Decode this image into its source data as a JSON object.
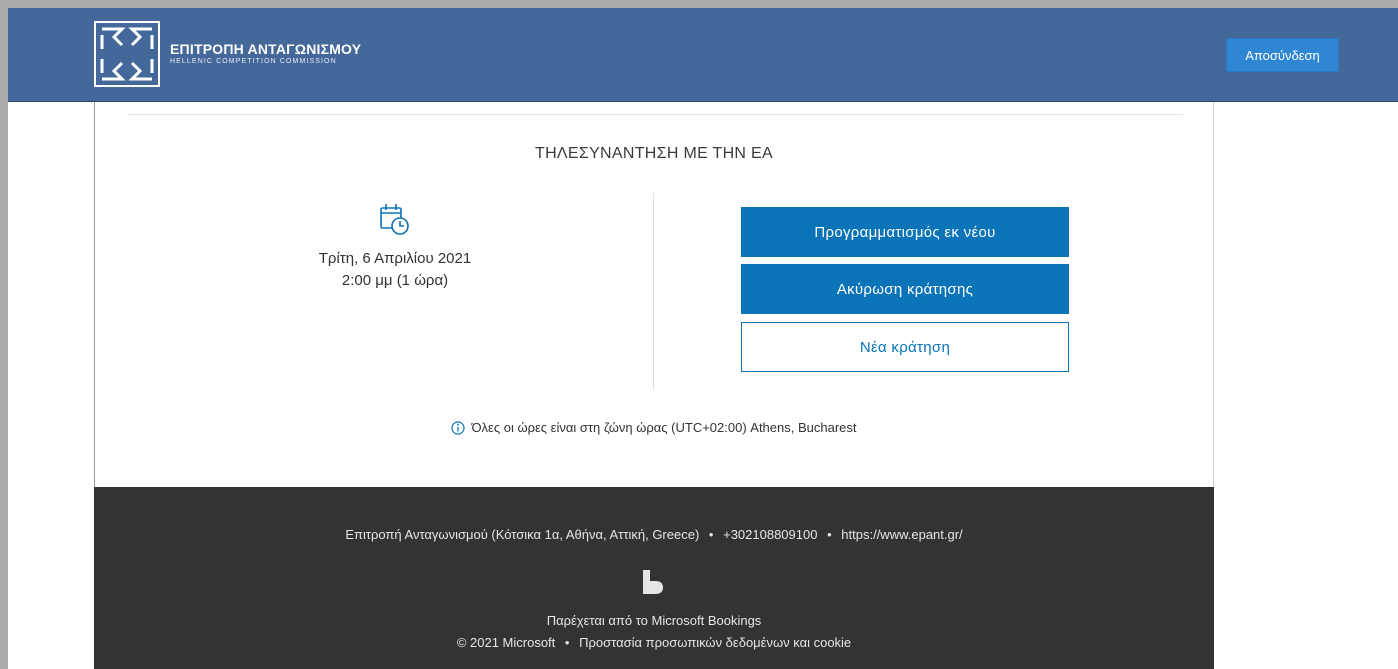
{
  "header": {
    "logo_title": "ΕΠΙΤΡΟΠΗ ΑΝΤΑΓΩΝΙΣΜΟΥ",
    "logo_subtitle": "HELLENIC COMPETITION COMMISSION",
    "logout_label": "Αποσύνδεση"
  },
  "booking": {
    "title": "ΤΗΛΕΣΥΝΑΝΤΗΣΗ ΜΕ ΤΗΝ ΕΑ",
    "date": "Τρίτη, 6 Απριλίου 2021",
    "time": "2:00 μμ (1 ώρα)",
    "reschedule_label": "Προγραμματισμός εκ νέου",
    "cancel_label": "Ακύρωση κράτησης",
    "new_booking_label": "Νέα κράτηση",
    "timezone_note": "Όλες οι ώρες είναι στη ζώνη ώρας (UTC+02:00) Athens, Bucharest"
  },
  "footer": {
    "address": "Επιτροπή Ανταγωνισμού (Κότσικα 1α, Αθήνα, Αττική, Greece)",
    "phone": "+302108809100",
    "website": "https://www.epant.gr/",
    "separator": "•",
    "powered_by": "Παρέχεται από το Microsoft Bookings",
    "copyright": "© 2021 Microsoft",
    "privacy_link": "Προστασία προσωπικών δεδομένων και cookie"
  },
  "colors": {
    "header_bg": "#44689a",
    "primary_button": "#0b73b8",
    "logout_button": "#2f86d3",
    "footer_bg": "#333333"
  },
  "icons": {
    "logo": "hcc-logo-icon",
    "calendar": "calendar-clock-icon",
    "info": "info-icon",
    "bookings": "microsoft-bookings-icon"
  }
}
